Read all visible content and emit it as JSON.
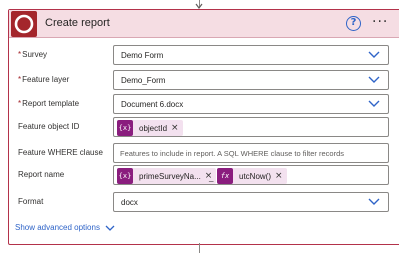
{
  "card": {
    "title": "Create report",
    "help_glyph": "?",
    "more_glyph": "···"
  },
  "fields": {
    "survey": {
      "label": "Survey",
      "required": "*",
      "value": "Demo Form"
    },
    "feature_layer": {
      "label": "Feature layer",
      "required": "*",
      "value": "Demo_Form"
    },
    "report_template": {
      "label": "Report template",
      "required": "*",
      "value": "Document 6.docx"
    },
    "feature_object_id": {
      "label": "Feature object ID",
      "token": {
        "icon": "{x}",
        "label": "objectId",
        "remove": "×"
      }
    },
    "feature_where": {
      "label": "Feature WHERE clause",
      "placeholder": "Features to include in report. A SQL WHERE clause to filter records"
    },
    "report_name": {
      "label": "Report name",
      "token1": {
        "icon": "{x}",
        "label": "primeSurveyNa...",
        "remove": "×"
      },
      "separator": "_",
      "token2": {
        "icon": "fx",
        "label": "utcNow()",
        "remove": "×"
      }
    },
    "format": {
      "label": "Format",
      "value": "docx"
    }
  },
  "advanced_options": {
    "label": "Show advanced options"
  },
  "colors": {
    "accent_border": "#b3324a",
    "header_bg": "#f5dde3",
    "logo_bg": "#a4262c",
    "token_icon_bg": "#8a1d7e",
    "token_bg": "#f3e1ef",
    "link_blue": "#2f64c8"
  }
}
